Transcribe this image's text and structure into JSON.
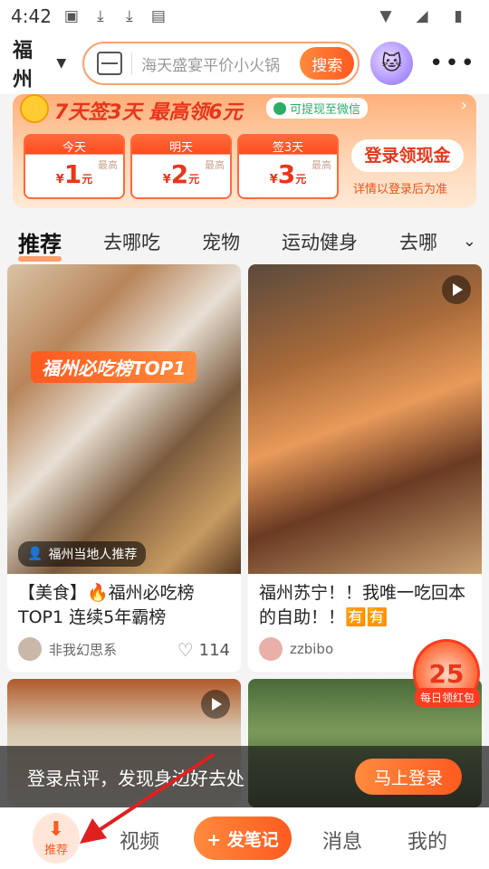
{
  "status_bar": {
    "time": "4:42"
  },
  "header": {
    "city": "福州",
    "search_placeholder": "海天盛宴平价小火锅",
    "search_button": "搜索"
  },
  "banner": {
    "title": "7天签3天 最高领6元",
    "wechat_badge": "可提现至微信",
    "days": [
      {
        "label": "今天",
        "amount": "1",
        "max": "最高"
      },
      {
        "label": "明天",
        "amount": "2",
        "max": "最高"
      },
      {
        "label": "签3天",
        "amount": "3",
        "max": "最高"
      }
    ],
    "yen_symbol": "¥",
    "yuan_unit": "元",
    "cta": "登录领现金",
    "note": "详情以登录后为准"
  },
  "tabs": [
    "推荐",
    "去哪吃",
    "宠物",
    "运动健身",
    "去哪"
  ],
  "feed": {
    "card1": {
      "overlay": "福州必吃榜TOP1",
      "tag": "福州当地人推荐",
      "title": "【美食】🔥福州必吃榜TOP1 连续5年霸榜",
      "author": "非我幻思系",
      "likes": "114"
    },
    "card2": {
      "title": "福州苏宁！！我唯一吃回本的自助！！🈶🈶",
      "author": "zzbibo"
    }
  },
  "red_packet": {
    "number": "25",
    "label": "每日领红包"
  },
  "login_prompt": {
    "text": "登录点评，发现身边好去处",
    "button": "马上登录"
  },
  "bottom_nav": {
    "recommend": "推荐",
    "video": "视频",
    "post": "+ 发笔记",
    "messages": "消息",
    "mine": "我的"
  },
  "colors": {
    "accent": "#ff5a1f",
    "brand_orange": "#ff8a3d"
  }
}
